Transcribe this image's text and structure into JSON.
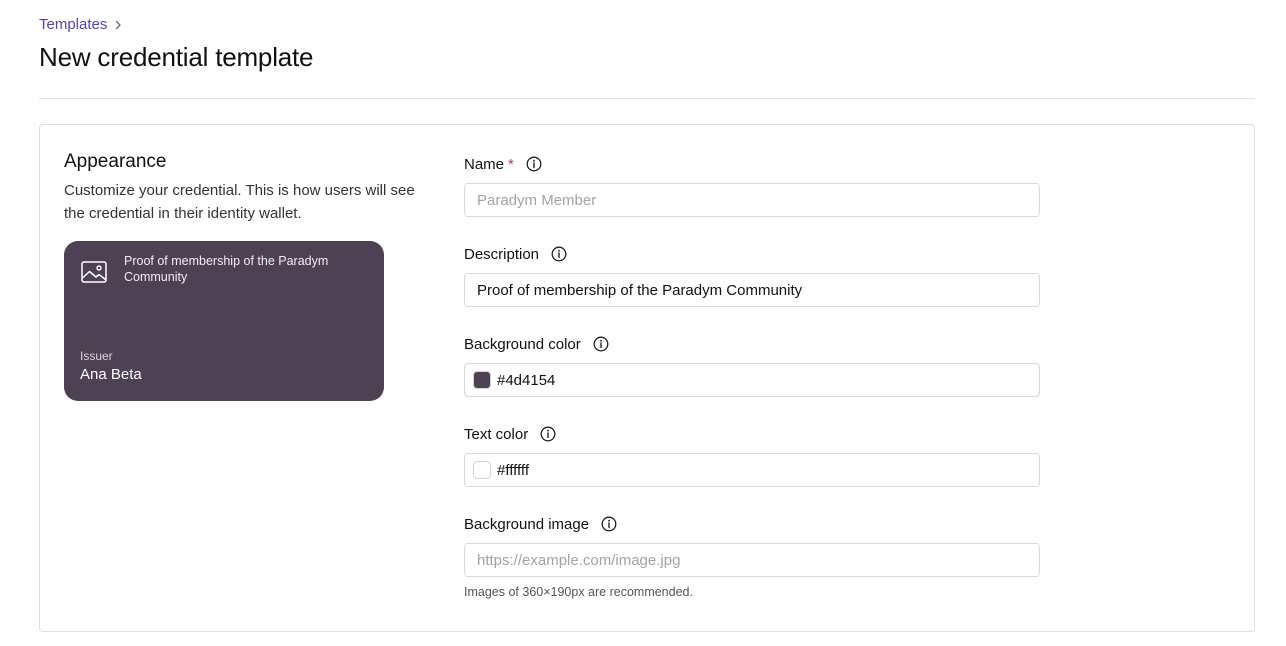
{
  "header": {
    "breadcrumb": "Templates",
    "title": "New credential template"
  },
  "appearance": {
    "title": "Appearance",
    "description": "Customize your credential. This is how users will see the credential in their identity wallet."
  },
  "preview": {
    "image_icon": "image-icon",
    "description": "Proof of membership of the Paradym Community",
    "issuer_label": "Issuer",
    "issuer_name": "Ana Beta",
    "background": "#4d4154",
    "text_color": "#ffffff"
  },
  "form": {
    "name": {
      "label": "Name",
      "required_mark": "*",
      "value": "",
      "placeholder": "Paradym Member"
    },
    "description": {
      "label": "Description",
      "value": "Proof of membership of the Paradym Community"
    },
    "background_color": {
      "label": "Background color",
      "value": "#4d4154"
    },
    "text_color": {
      "label": "Text color",
      "value": "#ffffff"
    },
    "background_image": {
      "label": "Background image",
      "value": "",
      "placeholder": "https://example.com/image.jpg",
      "hint": "Images of 360×190px are recommended."
    }
  },
  "colors": {
    "accent_link": "#5b3fb8",
    "required": "#c8323a"
  }
}
